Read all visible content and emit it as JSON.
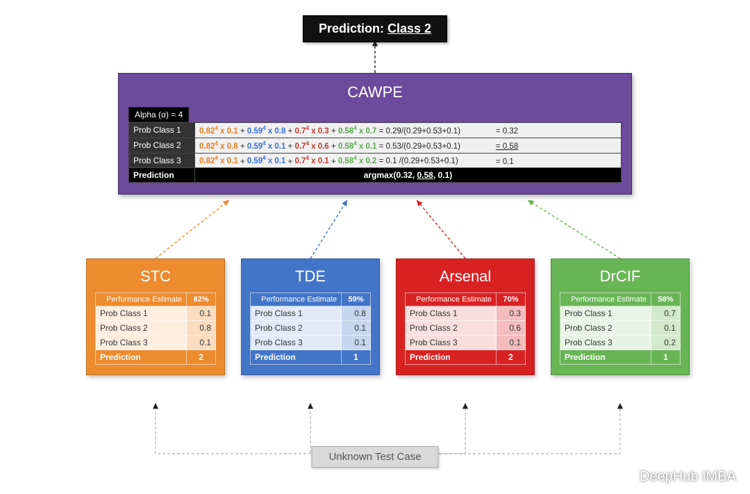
{
  "prediction": {
    "prefix": "Prediction: ",
    "value": "Class 2"
  },
  "cawpe": {
    "title": "CAWPE",
    "alpha_label": "Alpha (α) = 4",
    "rows": [
      {
        "label": "Prob Class 1",
        "terms": [
          "0.82⁴ x 0.1",
          "0.59⁴ x 0.8",
          "0.7⁴ x 0.3",
          "0.58⁴ x 0.7"
        ],
        "sum": "= 0.29/(0.29+0.53+0.1)",
        "result": "= 0.32"
      },
      {
        "label": "Prob Class 2",
        "terms": [
          "0.82⁴ x 0.8",
          "0.59⁴ x 0.1",
          "0.7⁴ x 0.6",
          "0.58⁴ x 0.1"
        ],
        "sum": "= 0.53/(0.29+0.53+0.1)",
        "result": "= 0.58",
        "u": true
      },
      {
        "label": "Prob Class 3",
        "terms": [
          "0.82⁴ x 0.1",
          "0.59⁴ x 0.1",
          "0.7⁴ x 0.1",
          "0.58⁴ x 0.2"
        ],
        "sum": "= 0.1  /(0.29+0.53+0.1)",
        "result": "= 0.1"
      }
    ],
    "pred_label": "Prediction",
    "pred_value": "argmax(0.32, 0.58, 0.1)"
  },
  "classifiers": [
    {
      "key": "stc",
      "name": "STC",
      "perf_label": "Performance Estimate",
      "perf": "82%",
      "probs": [
        [
          "Prob Class 1",
          "0.1"
        ],
        [
          "Prob Class 2",
          "0.8"
        ],
        [
          "Prob Class 3",
          "0.1"
        ]
      ],
      "pred_label": "Prediction",
      "pred": "2"
    },
    {
      "key": "tde",
      "name": "TDE",
      "perf_label": "Performance Estimate",
      "perf": "59%",
      "probs": [
        [
          "Prob Class 1",
          "0.8"
        ],
        [
          "Prob Class 2",
          "0.1"
        ],
        [
          "Prob Class 3",
          "0.1"
        ]
      ],
      "pred_label": "Prediction",
      "pred": "1"
    },
    {
      "key": "ars",
      "name": "Arsenal",
      "perf_label": "Performance Estimate",
      "perf": "70%",
      "probs": [
        [
          "Prob Class 1",
          "0.3"
        ],
        [
          "Prob Class 2",
          "0.6"
        ],
        [
          "Prob Class 3",
          "0.1"
        ]
      ],
      "pred_label": "Prediction",
      "pred": "2"
    },
    {
      "key": "drcif",
      "name": "DrCIF",
      "perf_label": "Performance Estimate",
      "perf": "58%",
      "probs": [
        [
          "Prob Class 1",
          "0.7"
        ],
        [
          "Prob Class 2",
          "0.1"
        ],
        [
          "Prob Class 3",
          "0.2"
        ]
      ],
      "pred_label": "Prediction",
      "pred": "1"
    }
  ],
  "utc": "Unknown Test Case",
  "watermark": "DeepHub IMBA"
}
